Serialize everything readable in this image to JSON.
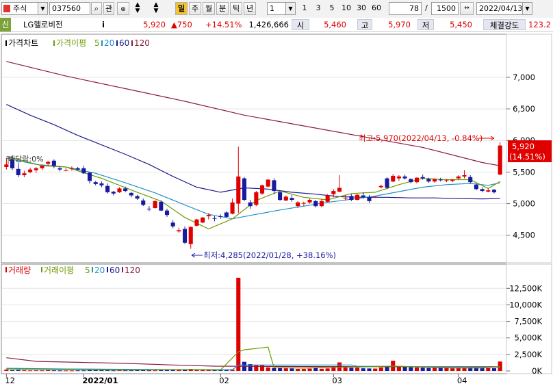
{
  "toolbar": {
    "market": "주식",
    "code": "037560",
    "search_icon": "search-icon",
    "interest": "관",
    "period_buttons": [
      "일",
      "주",
      "월",
      "분",
      "틱",
      "년"
    ],
    "interval_value": "1",
    "interval_buttons": [
      "1",
      "3",
      "5",
      "10",
      "30",
      "60"
    ],
    "view_count": "78",
    "separator": "/",
    "total_count": "1500",
    "date": "2022/04/13"
  },
  "info": {
    "credit_label": "신",
    "name": "LG헬로비전",
    "info_icon": "i",
    "price": "5,920",
    "change": "▲750",
    "change_pct": "+14.51%",
    "volume": "1,426,666",
    "open_label": "시",
    "open": "5,460",
    "high_label": "고",
    "high": "5,970",
    "low_label": "저",
    "low": "5,450",
    "strength_label": "체결강도",
    "strength": "123.2"
  },
  "price_panel": {
    "title": "가격차트",
    "ma_title": "가격이평",
    "ma_periods": [
      "5",
      "20",
      "60",
      "120"
    ],
    "high_annotation": "최고:5,970(2022/04/13, -0.84%)",
    "low_annotation": "최저:4,285(2022/01/28, +38.16%)",
    "dividend_label": "배당락:0%",
    "last_price_tag": "5,920",
    "last_pct_tag": "(14.51%)"
  },
  "volume_panel": {
    "title": "거래량",
    "ma_title": "거래이평",
    "ma_periods": [
      "5",
      "20",
      "60",
      "120"
    ]
  },
  "colors": {
    "up": "#e00000",
    "down": "#1a1aa0",
    "ma5": "#6c9a00",
    "ma20": "#1e90c8",
    "ma60": "#1a1a8c",
    "ma120": "#8a1a3a"
  },
  "chart_data": [
    {
      "type": "candlestick",
      "title": "가격차트",
      "ylim": [
        4150,
        7400
      ],
      "y_ticks": [
        4500,
        5000,
        5500,
        6000,
        6500,
        7000
      ],
      "y_tick_labels": [
        "4,500",
        "5,000",
        "5,500",
        "6,000",
        "6,500",
        "7,000"
      ],
      "x_tick_labels": [
        "12",
        "2022/01",
        "02",
        "03",
        "04"
      ],
      "x_tick_index": [
        0,
        13,
        36,
        55,
        76
      ],
      "ohlc": [
        [
          5580,
          5720,
          5540,
          5620
        ],
        [
          5700,
          5760,
          5530,
          5560
        ],
        [
          5550,
          5640,
          5420,
          5450
        ],
        [
          5450,
          5520,
          5420,
          5480
        ],
        [
          5500,
          5570,
          5480,
          5540
        ],
        [
          5530,
          5580,
          5490,
          5560
        ],
        [
          5560,
          5620,
          5530,
          5600
        ],
        [
          5630,
          5680,
          5600,
          5660
        ],
        [
          5680,
          5700,
          5560,
          5600
        ],
        [
          5560,
          5590,
          5510,
          5540
        ],
        [
          5530,
          5560,
          5510,
          5530
        ],
        [
          5550,
          5590,
          5520,
          5560
        ],
        [
          5560,
          5580,
          5520,
          5540
        ],
        [
          5560,
          5600,
          5470,
          5480
        ],
        [
          5490,
          5500,
          5320,
          5360
        ],
        [
          5340,
          5360,
          5290,
          5310
        ],
        [
          5320,
          5350,
          5260,
          5290
        ],
        [
          5280,
          5320,
          5160,
          5180
        ],
        [
          5190,
          5200,
          5130,
          5160
        ],
        [
          5180,
          5260,
          5170,
          5240
        ],
        [
          5240,
          5270,
          5180,
          5200
        ],
        [
          5170,
          5190,
          5100,
          5130
        ],
        [
          5120,
          5140,
          5060,
          5080
        ],
        [
          5050,
          5080,
          4960,
          4980
        ],
        [
          4920,
          4960,
          4880,
          4910
        ],
        [
          4930,
          5060,
          4920,
          5040
        ],
        [
          5030,
          5050,
          4880,
          4890
        ],
        [
          4890,
          4920,
          4790,
          4820
        ],
        [
          4700,
          4740,
          4610,
          4640
        ],
        [
          4560,
          4620,
          4540,
          4580
        ],
        [
          4600,
          4640,
          4360,
          4380
        ],
        [
          4360,
          4640,
          4285,
          4630
        ],
        [
          4650,
          4760,
          4640,
          4750
        ],
        [
          4700,
          4790,
          4690,
          4780
        ],
        [
          4800,
          4850,
          4750,
          4820
        ],
        [
          4770,
          4800,
          4720,
          4760
        ],
        [
          4800,
          4830,
          4760,
          4790
        ],
        [
          4860,
          4880,
          4780,
          4790
        ],
        [
          4840,
          5080,
          4830,
          5020
        ],
        [
          5000,
          5900,
          4850,
          5430
        ],
        [
          5400,
          5420,
          5040,
          5060
        ],
        [
          5020,
          5060,
          4920,
          4960
        ],
        [
          4980,
          5200,
          4960,
          5180
        ],
        [
          5160,
          5300,
          5140,
          5290
        ],
        [
          5270,
          5390,
          5260,
          5380
        ],
        [
          5370,
          5400,
          5150,
          5200
        ],
        [
          5180,
          5210,
          5040,
          5060
        ],
        [
          5050,
          5130,
          5040,
          5110
        ],
        [
          5090,
          5140,
          5030,
          5060
        ],
        [
          4960,
          5040,
          4930,
          5020
        ],
        [
          5000,
          5030,
          4960,
          5010
        ],
        [
          5020,
          5080,
          5000,
          5060
        ],
        [
          5040,
          5060,
          4940,
          4960
        ],
        [
          4960,
          5070,
          4940,
          5040
        ],
        [
          5030,
          5150,
          5020,
          5130
        ],
        [
          5150,
          5230,
          5100,
          5200
        ],
        [
          5190,
          5450,
          5180,
          5250
        ],
        [
          5080,
          5140,
          5050,
          5090
        ],
        [
          5120,
          5150,
          5040,
          5060
        ],
        [
          5060,
          5150,
          5050,
          5140
        ],
        [
          5130,
          5180,
          5080,
          5100
        ],
        [
          5100,
          5140,
          5010,
          5040
        ],
        [
          5100,
          5120,
          5090,
          5110
        ],
        [
          5260,
          5300,
          5240,
          5280
        ],
        [
          5400,
          5420,
          5230,
          5250
        ],
        [
          5350,
          5470,
          5340,
          5440
        ],
        [
          5400,
          5450,
          5360,
          5430
        ],
        [
          5430,
          5460,
          5380,
          5400
        ],
        [
          5390,
          5400,
          5320,
          5340
        ],
        [
          5340,
          5420,
          5320,
          5410
        ],
        [
          5420,
          5460,
          5380,
          5400
        ],
        [
          5390,
          5410,
          5330,
          5350
        ],
        [
          5350,
          5400,
          5330,
          5390
        ],
        [
          5380,
          5410,
          5350,
          5370
        ],
        [
          5360,
          5390,
          5340,
          5370
        ],
        [
          5360,
          5390,
          5340,
          5380
        ],
        [
          5400,
          5450,
          5380,
          5430
        ],
        [
          5430,
          5530,
          5400,
          5450
        ],
        [
          5420,
          5450,
          5320,
          5340
        ],
        [
          5300,
          5320,
          5210,
          5230
        ],
        [
          5230,
          5260,
          5180,
          5200
        ],
        [
          5190,
          5240,
          5180,
          5210
        ],
        [
          5220,
          5230,
          5160,
          5180
        ],
        [
          5460,
          5970,
          5450,
          5920
        ]
      ],
      "ma5": [
        [
          0,
          5750
        ],
        [
          6,
          5600
        ],
        [
          10,
          5580
        ],
        [
          16,
          5400
        ],
        [
          22,
          5180
        ],
        [
          26,
          5040
        ],
        [
          30,
          4780
        ],
        [
          34,
          4600
        ],
        [
          38,
          4760
        ],
        [
          42,
          5050
        ],
        [
          46,
          5200
        ],
        [
          50,
          5100
        ],
        [
          54,
          5060
        ],
        [
          58,
          5160
        ],
        [
          62,
          5180
        ],
        [
          66,
          5300
        ],
        [
          70,
          5400
        ],
        [
          74,
          5380
        ],
        [
          78,
          5380
        ],
        [
          81,
          5240
        ],
        [
          83,
          5350
        ]
      ],
      "ma20": [
        [
          0,
          5720
        ],
        [
          5,
          5620
        ],
        [
          10,
          5580
        ],
        [
          15,
          5480
        ],
        [
          20,
          5330
        ],
        [
          25,
          5170
        ],
        [
          30,
          4980
        ],
        [
          34,
          4830
        ],
        [
          38,
          4760
        ],
        [
          42,
          4830
        ],
        [
          46,
          4900
        ],
        [
          50,
          4960
        ],
        [
          54,
          5020
        ],
        [
          58,
          5070
        ],
        [
          62,
          5120
        ],
        [
          66,
          5190
        ],
        [
          70,
          5260
        ],
        [
          74,
          5300
        ],
        [
          78,
          5320
        ],
        [
          81,
          5290
        ],
        [
          83,
          5330
        ]
      ],
      "ma60": [
        [
          0,
          6570
        ],
        [
          4,
          6400
        ],
        [
          8,
          6250
        ],
        [
          12,
          6080
        ],
        [
          16,
          5930
        ],
        [
          20,
          5780
        ],
        [
          24,
          5620
        ],
        [
          28,
          5430
        ],
        [
          32,
          5260
        ],
        [
          36,
          5180
        ],
        [
          40,
          5250
        ],
        [
          44,
          5230
        ],
        [
          48,
          5180
        ],
        [
          52,
          5150
        ],
        [
          56,
          5110
        ],
        [
          60,
          5100
        ],
        [
          64,
          5100
        ],
        [
          68,
          5090
        ],
        [
          72,
          5090
        ],
        [
          76,
          5080
        ],
        [
          80,
          5075
        ],
        [
          83,
          5080
        ]
      ],
      "ma120": [
        [
          0,
          7250
        ],
        [
          10,
          7020
        ],
        [
          20,
          6820
        ],
        [
          30,
          6620
        ],
        [
          40,
          6400
        ],
        [
          50,
          6230
        ],
        [
          60,
          6060
        ],
        [
          70,
          5890
        ],
        [
          80,
          5650
        ],
        [
          83,
          5600
        ]
      ]
    },
    {
      "type": "bar",
      "title": "거래량",
      "ylim": [
        0,
        14500
      ],
      "y_ticks": [
        0,
        2500,
        5000,
        7500,
        10000,
        12500
      ],
      "y_tick_labels": [
        "0K",
        "2,500K",
        "5,000K",
        "7,500K",
        "10,000K",
        "12,500K"
      ],
      "values": [
        210,
        120,
        150,
        110,
        80,
        90,
        90,
        120,
        90,
        80,
        70,
        70,
        80,
        80,
        140,
        120,
        100,
        120,
        80,
        110,
        90,
        90,
        110,
        120,
        90,
        90,
        110,
        120,
        190,
        160,
        240,
        310,
        200,
        170,
        120,
        110,
        110,
        120,
        190,
        14100,
        1380,
        1030,
        940,
        930,
        540,
        470,
        450,
        400,
        380,
        310,
        300,
        350,
        460,
        330,
        380,
        660,
        1290,
        560,
        480,
        500,
        400,
        380,
        360,
        520,
        600,
        1550,
        720,
        670,
        560,
        520,
        480,
        430,
        480,
        460,
        420,
        400,
        440,
        450,
        530,
        500,
        450,
        420,
        410,
        1426
      ],
      "ma5": [
        [
          0,
          300
        ],
        [
          10,
          200
        ],
        [
          20,
          150
        ],
        [
          30,
          200
        ],
        [
          36,
          150
        ],
        [
          39,
          2900
        ],
        [
          40,
          3200
        ],
        [
          43,
          3500
        ],
        [
          44,
          3600
        ],
        [
          45,
          500
        ],
        [
          50,
          420
        ],
        [
          55,
          550
        ],
        [
          60,
          600
        ],
        [
          65,
          750
        ],
        [
          70,
          550
        ],
        [
          75,
          450
        ],
        [
          80,
          450
        ],
        [
          83,
          650
        ]
      ],
      "ma20": [
        [
          0,
          400
        ],
        [
          10,
          300
        ],
        [
          20,
          250
        ],
        [
          30,
          210
        ],
        [
          38,
          200
        ],
        [
          39,
          900
        ],
        [
          44,
          900
        ],
        [
          58,
          900
        ],
        [
          59,
          700
        ],
        [
          66,
          700
        ],
        [
          70,
          600
        ],
        [
          83,
          560
        ]
      ],
      "ma120": [
        [
          0,
          2000
        ],
        [
          5,
          1450
        ],
        [
          12,
          1300
        ],
        [
          20,
          1150
        ],
        [
          28,
          900
        ],
        [
          35,
          720
        ],
        [
          40,
          700
        ],
        [
          50,
          660
        ],
        [
          60,
          640
        ],
        [
          70,
          640
        ],
        [
          83,
          640
        ]
      ]
    }
  ]
}
